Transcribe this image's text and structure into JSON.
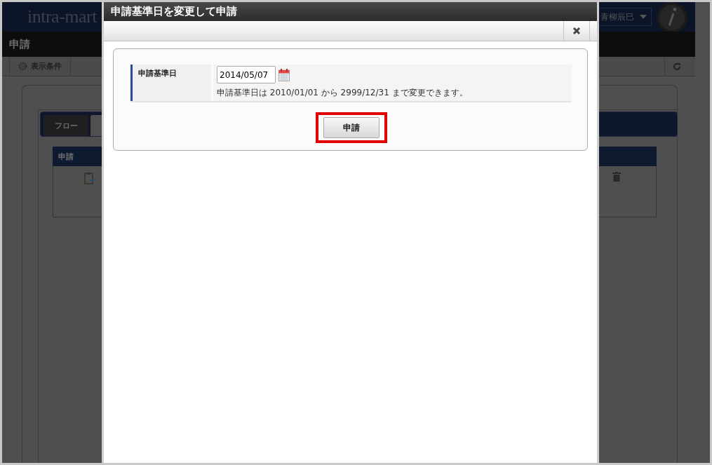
{
  "page": {
    "logo": "intra-mart",
    "user_menu": "青柳辰巳",
    "title": "申請",
    "toolbar": {
      "display_conditions": "表示条件"
    },
    "tabs": [
      {
        "label": "フロー",
        "selected": false
      },
      {
        "selected": true
      }
    ],
    "table": {
      "header": "申請"
    }
  },
  "dialog": {
    "title": "申請基準日を変更して申請",
    "fields": [
      {
        "label": "申請基準日",
        "value": "2014/05/07",
        "hint": "申請基準日は 2010/01/01 から 2999/12/31 まで変更できます。"
      }
    ],
    "button": {
      "label": "申請",
      "highlighted": true
    }
  }
}
